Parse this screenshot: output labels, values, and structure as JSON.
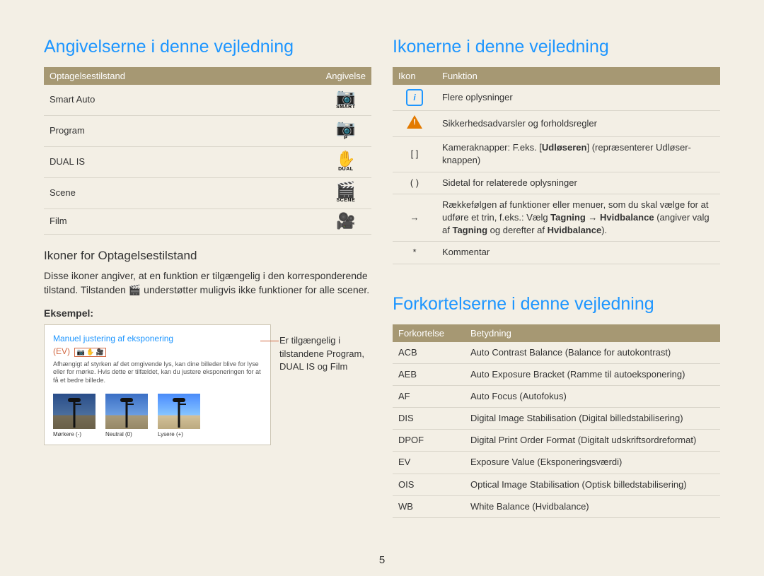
{
  "page_number": "5",
  "left": {
    "heading": "Angivelserne i denne vejledning",
    "table_headers": {
      "mode": "Optagelsestilstand",
      "indication": "Angivelse"
    },
    "modes": [
      {
        "label": "Smart Auto",
        "icon_name": "camera-smart-icon",
        "glyph": "📷",
        "sub": "SMART"
      },
      {
        "label": "Program",
        "icon_name": "camera-p-icon",
        "glyph": "📷",
        "sub": "P"
      },
      {
        "label": "DUAL IS",
        "icon_name": "dual-is-icon",
        "glyph": "✋",
        "sub": "DUAL"
      },
      {
        "label": "Scene",
        "icon_name": "scene-icon",
        "glyph": "🎬",
        "sub": "SCENE"
      },
      {
        "label": "Film",
        "icon_name": "film-icon",
        "glyph": "🎥",
        "sub": ""
      }
    ],
    "subheading": "Ikoner for Optagelsestilstand",
    "body": "Disse ikoner angiver, at en funktion er tilgængelig i den korresponderende tilstand. Tilstanden 🎬 understøtter muligvis ikke funktioner for alle scener.",
    "example_label": "Eksempel:",
    "callout": {
      "title": "Manuel justering af eksponering",
      "ev": "(EV)",
      "tiny_icons": "📷 ✋ 🎥",
      "desc": "Afhængigt af styrken af det omgivende lys, kan dine billeder blive for lyse eller for mørke. Hvis dette er tilfældet, kan du justere eksponeringen for at få et bedre billede.",
      "thumbs": [
        {
          "caption": "Mørkere (-)",
          "variant": "dark"
        },
        {
          "caption": "Neutral (0)",
          "variant": ""
        },
        {
          "caption": "Lysere (+)",
          "variant": "light"
        }
      ],
      "aside": "Er tilgængelig i tilstandene Program, DUAL IS og Film"
    }
  },
  "right": {
    "icons_heading": "Ikonerne i denne vejledning",
    "icons_headers": {
      "icon": "Ikon",
      "func": "Funktion"
    },
    "icons_rows": [
      {
        "icon_sym": "info",
        "text": "Flere oplysninger"
      },
      {
        "icon_sym": "warn",
        "text": "Sikkerhedsadvarsler og forholdsregler"
      },
      {
        "icon_sym": "[  ]",
        "html": "Kameraknapper: F.eks. [<b>Udløseren</b>] (repræsenterer Udløser-knappen)"
      },
      {
        "icon_sym": "(  )",
        "text": "Sidetal for relaterede oplysninger"
      },
      {
        "icon_sym": "→",
        "html": "Rækkefølgen af funktioner eller menuer, som du skal vælge for at udføre et trin, f.eks.: Vælg <b>Tagning</b> → <b>Hvidbalance</b> (angiver valg af <b>Tagning</b> og derefter af <b>Hvidbalance</b>)."
      },
      {
        "icon_sym": "*",
        "text": "Kommentar"
      }
    ],
    "abbr_heading": "Forkortelserne i denne vejledning",
    "abbr_headers": {
      "short": "Forkortelse",
      "meaning": "Betydning"
    },
    "abbr_rows": [
      {
        "short": "ACB",
        "meaning": "Auto Contrast Balance (Balance for autokontrast)"
      },
      {
        "short": "AEB",
        "meaning": "Auto Exposure Bracket (Ramme til autoeksponering)"
      },
      {
        "short": "AF",
        "meaning": "Auto Focus (Autofokus)"
      },
      {
        "short": "DIS",
        "meaning": "Digital Image Stabilisation (Digital billedstabilisering)"
      },
      {
        "short": "DPOF",
        "meaning": "Digital Print Order Format (Digitalt udskriftsordreformat)"
      },
      {
        "short": "EV",
        "meaning": "Exposure Value (Eksponeringsværdi)"
      },
      {
        "short": "OIS",
        "meaning": "Optical Image Stabilisation (Optisk billedstabilisering)"
      },
      {
        "short": "WB",
        "meaning": "White Balance (Hvidbalance)"
      }
    ]
  }
}
